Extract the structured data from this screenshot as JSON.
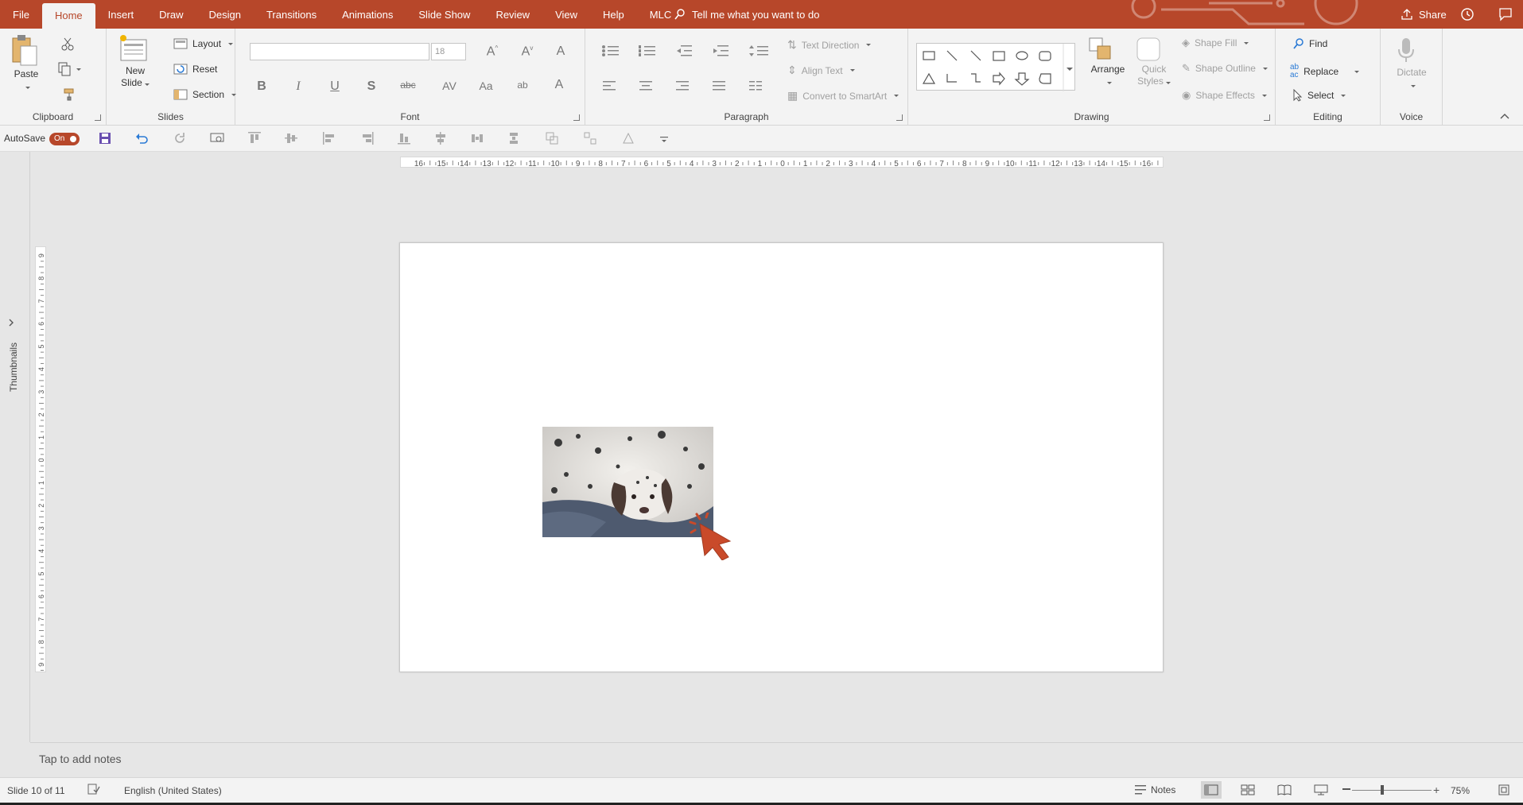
{
  "tabs": [
    "File",
    "Home",
    "Insert",
    "Draw",
    "Design",
    "Transitions",
    "Animations",
    "Slide Show",
    "Review",
    "View",
    "Help",
    "MLC"
  ],
  "active_tab": "Home",
  "tellme": "Tell me what you want to do",
  "share": "Share",
  "ribbon": {
    "clipboard": {
      "label": "Clipboard",
      "paste": "Paste"
    },
    "slides": {
      "label": "Slides",
      "new_slide_1": "New",
      "new_slide_2": "Slide",
      "layout": "Layout",
      "reset": "Reset",
      "section": "Section"
    },
    "font": {
      "label": "Font",
      "font_name": "",
      "font_size": "18"
    },
    "paragraph": {
      "label": "Paragraph",
      "text_direction": "Text Direction",
      "align_text": "Align Text",
      "convert_smartart": "Convert to SmartArt"
    },
    "drawing": {
      "label": "Drawing",
      "arrange": "Arrange",
      "quick_styles_1": "Quick",
      "quick_styles_2": "Styles",
      "shape_fill": "Shape Fill",
      "shape_outline": "Shape Outline",
      "shape_effects": "Shape Effects"
    },
    "editing": {
      "label": "Editing",
      "find": "Find",
      "replace": "Replace",
      "select": "Select"
    },
    "voice": {
      "label": "Voice",
      "dictate": "Dictate"
    }
  },
  "qat": {
    "autosave": "AutoSave",
    "toggle": "On"
  },
  "thumbnails": "Thumbnails",
  "notes_placeholder": "Tap to add notes",
  "status": {
    "slide": "Slide 10 of 11",
    "language": "English (United States)",
    "notes": "Notes",
    "zoom": "75%"
  },
  "accent_color": "#b7472a"
}
